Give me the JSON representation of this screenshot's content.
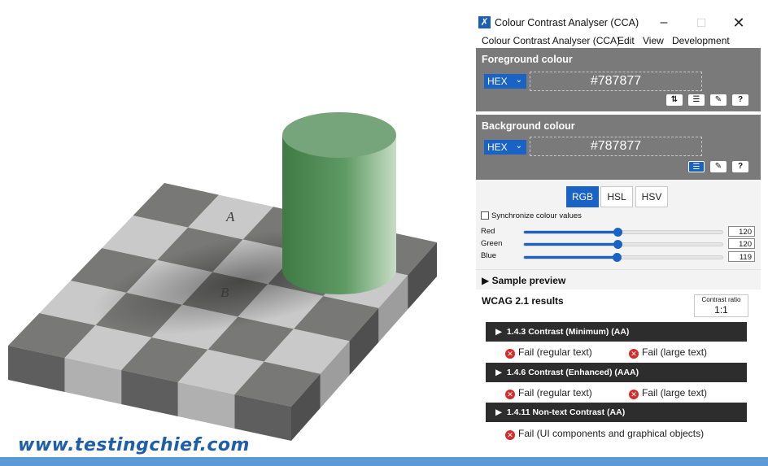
{
  "website": {
    "url": "www.testingchief.com"
  },
  "illustration": {
    "square_a": "A",
    "square_b": "B"
  },
  "window": {
    "title": "Colour Contrast Analyser (CCA)",
    "controls": {
      "minimize": "–",
      "maximize": "☐",
      "close": "✕"
    }
  },
  "menu": [
    "Colour Contrast Analyser (CCA)",
    "Edit",
    "View",
    "Development"
  ],
  "foreground": {
    "title": "Foreground colour",
    "mode": "HEX",
    "value": "#787877",
    "tools": [
      "swap-icon",
      "sliders-icon",
      "eyedropper-icon",
      "help-icon"
    ]
  },
  "background": {
    "title": "Background colour",
    "mode": "HEX",
    "value": "#787877",
    "tools": [
      "sliders-icon",
      "eyedropper-icon",
      "help-icon"
    ]
  },
  "colour_tabs": {
    "rgb": "RGB",
    "hsl": "HSL",
    "hsv": "HSV",
    "active": "RGB"
  },
  "sync": {
    "label": "Synchronize colour values",
    "checked": false
  },
  "sliders": {
    "red": {
      "label": "Red",
      "value": "120",
      "fraction": 0.47
    },
    "green": {
      "label": "Green",
      "value": "120",
      "fraction": 0.47
    },
    "blue": {
      "label": "Blue",
      "value": "119",
      "fraction": 0.467
    }
  },
  "sample_preview": "Sample preview",
  "wcag": {
    "title": "WCAG 2.1 results",
    "ratio_label": "Contrast ratio",
    "ratio_value": "1:1",
    "criteria": [
      {
        "title": "1.4.3 Contrast (Minimum) (AA)",
        "results": [
          "Fail (regular text)",
          "Fail (large text)"
        ]
      },
      {
        "title": "1.4.6 Contrast (Enhanced) (AAA)",
        "results": [
          "Fail (regular text)",
          "Fail (large text)"
        ]
      },
      {
        "title": "1.4.11 Non-text Contrast (AA)",
        "results": [
          "Fail (UI components and graphical objects)"
        ]
      }
    ]
  },
  "colors": {
    "accent": "#1a63c4",
    "panel": "#7a7a7a",
    "fail": "#d42b2b",
    "bottom_bar": "#5b9bd5"
  }
}
